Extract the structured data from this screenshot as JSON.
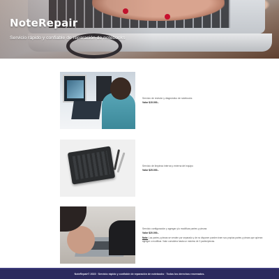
{
  "header": {
    "brand": "NoteRepair",
    "tagline": "Servicio rápido y confiable de reparación de notebooks"
  },
  "services": [
    {
      "description": "Servicio de revisión y diagnóstico de notebooks",
      "price": "Valor $15.000.-"
    },
    {
      "description": "Servicio de limpieza interna y externa del equipo",
      "price": "Valor $25.000.-"
    },
    {
      "description": "Servicio configuración y agregar y/o modificar partes y piezas",
      "price": "Valor $20.000.-",
      "note_label": "Nota:",
      "note": "Las partes y piezas se venden por separado y de no disponer pueden traer sus propias partes y piezas que quieran agregar o modificar. Valor considera hasta un máximo de 3 partes/piezas."
    }
  ],
  "footer": {
    "text": "NoteRepair© 2023 · Servicio rápido y confiable de reparación de notebooks · Todos los derechos reservados."
  },
  "colors": {
    "footer_bg": "#2c2a5e",
    "brand_text": "#ffffff"
  }
}
